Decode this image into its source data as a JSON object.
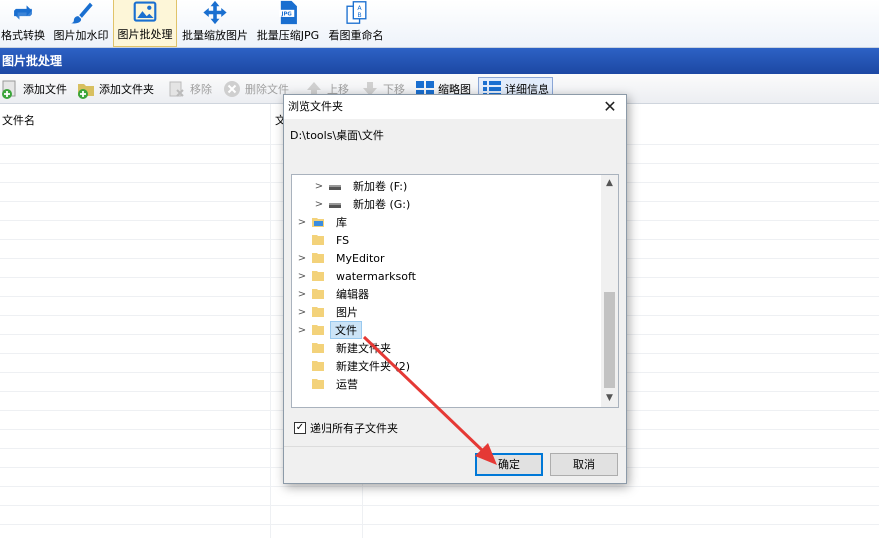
{
  "ribbon": {
    "items": [
      {
        "label": "格式转换"
      },
      {
        "label": "图片加水印"
      },
      {
        "label": "图片批处理"
      },
      {
        "label": "批量缩放图片"
      },
      {
        "label": "批量压缩JPG"
      },
      {
        "label": "看图重命名"
      }
    ]
  },
  "panel": {
    "title": "图片批处理"
  },
  "toolbar": {
    "add_file": "添加文件",
    "add_folder": "添加文件夹",
    "remove": "移除",
    "delete_file": "删除文件",
    "move_up": "上移",
    "move_down": "下移",
    "thumbnail": "缩略图",
    "details": "详细信息"
  },
  "list": {
    "columns": [
      "文件名",
      "文"
    ]
  },
  "dialog": {
    "title": "浏览文件夹",
    "current_path": "D:\\tools\\桌面\\文件",
    "tree_items": [
      {
        "label": "新加卷 (F:)"
      },
      {
        "label": "新加卷 (G:)"
      },
      {
        "label": "库"
      },
      {
        "label": "FS"
      },
      {
        "label": "MyEditor"
      },
      {
        "label": "watermarksoft"
      },
      {
        "label": "编辑器"
      },
      {
        "label": "图片"
      },
      {
        "label": "文件"
      },
      {
        "label": "新建文件夹"
      },
      {
        "label": "新建文件夹 (2)"
      },
      {
        "label": "运营"
      }
    ],
    "recursive_label": "递归所有子文件夹",
    "recursive_checked": true,
    "ok_label": "确定",
    "cancel_label": "取消"
  },
  "colors": {
    "panel_blue": "#1f4fae",
    "selection": "#cce4f7",
    "folder": "#f3d27a",
    "arrow_red": "#e53935"
  }
}
